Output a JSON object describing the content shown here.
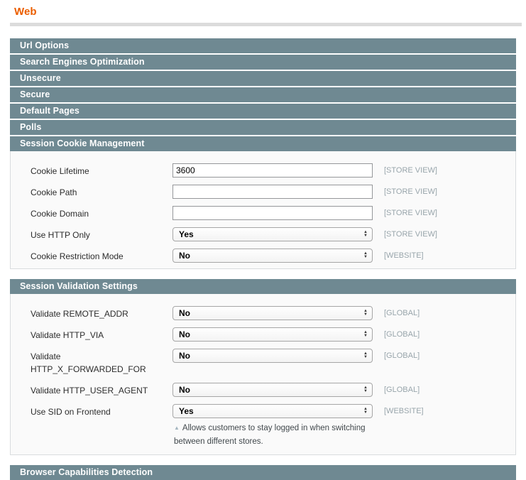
{
  "page": {
    "title": "Web"
  },
  "colors": {
    "accent_orange": "#eb5e00",
    "section_header_bg": "#6f8992",
    "fieldset_bg": "#fafafa",
    "scope_label": "#98a5ab"
  },
  "icons": {
    "select_arrow_up": "▲",
    "select_arrow_down": "▼",
    "note_marker": "▲"
  },
  "collapsed_sections": [
    "Url Options",
    "Search Engines Optimization",
    "Unsecure",
    "Secure",
    "Default Pages",
    "Polls"
  ],
  "session_cookie": {
    "title": "Session Cookie Management",
    "rows": [
      {
        "label": "Cookie Lifetime",
        "type": "text",
        "value": "3600",
        "scope": "[STORE VIEW]"
      },
      {
        "label": "Cookie Path",
        "type": "text",
        "value": "",
        "scope": "[STORE VIEW]"
      },
      {
        "label": "Cookie Domain",
        "type": "text",
        "value": "",
        "scope": "[STORE VIEW]"
      },
      {
        "label": "Use HTTP Only",
        "type": "select",
        "value": "Yes",
        "scope": "[STORE VIEW]"
      },
      {
        "label": "Cookie Restriction Mode",
        "type": "select",
        "value": "No",
        "scope": "[WEBSITE]"
      }
    ]
  },
  "session_validation": {
    "title": "Session Validation Settings",
    "rows": [
      {
        "label": "Validate REMOTE_ADDR",
        "type": "select",
        "value": "No",
        "scope": "[GLOBAL]"
      },
      {
        "label": "Validate HTTP_VIA",
        "type": "select",
        "value": "No",
        "scope": "[GLOBAL]"
      },
      {
        "label": "Validate HTTP_X_FORWARDED_FOR",
        "type": "select",
        "value": "No",
        "scope": "[GLOBAL]"
      },
      {
        "label": "Validate HTTP_USER_AGENT",
        "type": "select",
        "value": "No",
        "scope": "[GLOBAL]"
      },
      {
        "label": "Use SID on Frontend",
        "type": "select",
        "value": "Yes",
        "scope": "[WEBSITE]",
        "note": "Allows customers to stay logged in when switching between different stores."
      }
    ]
  },
  "browser_capabilities": {
    "title": "Browser Capabilities Detection"
  }
}
